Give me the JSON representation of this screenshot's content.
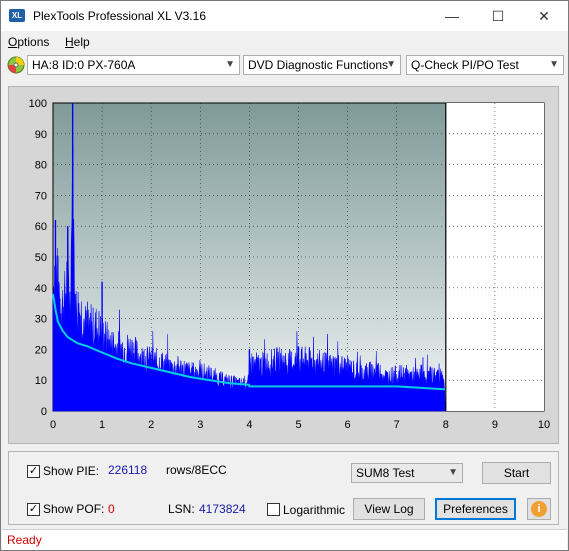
{
  "window": {
    "title": "PlexTools Professional XL V3.16",
    "icon_text": "XL"
  },
  "menu": [
    {
      "label": "Options",
      "ul": "O",
      "rest": "ptions"
    },
    {
      "label": "Help",
      "ul": "H",
      "rest": "elp"
    }
  ],
  "toolbar": {
    "drive": "HA:8 ID:0  PX-760A",
    "function": "DVD Diagnostic Functions",
    "test": "Q-Check PI/PO Test"
  },
  "chart_data": {
    "type": "area",
    "xlim": [
      0,
      10
    ],
    "ylim": [
      0,
      100
    ],
    "x_ticks": [
      "0",
      "1",
      "2",
      "3",
      "4",
      "5",
      "6",
      "7",
      "8",
      "9",
      "10"
    ],
    "y_ticks": [
      "0",
      "10",
      "20",
      "30",
      "40",
      "50",
      "60",
      "70",
      "80",
      "90",
      "100"
    ],
    "grid": true,
    "colors": {
      "pie": "#0000ff",
      "avg": "#00cfe0",
      "plot_bg": "#9fb4b4",
      "end_line": "#000000"
    },
    "series": [
      {
        "kind": "pie_envelope",
        "x": [
          0.0,
          0.05,
          0.1,
          0.15,
          0.2,
          0.25,
          0.3,
          0.35,
          0.4,
          0.45,
          0.5,
          0.6,
          0.7,
          0.8,
          0.9,
          1.0,
          1.2,
          1.4,
          1.6,
          1.8,
          2.0,
          2.2,
          2.4,
          2.6,
          2.8,
          3.0,
          3.2,
          3.4,
          3.6,
          3.8,
          3.99,
          4.0,
          4.2,
          4.4,
          4.6,
          4.8,
          5.0,
          5.2,
          5.4,
          5.6,
          5.8,
          6.0,
          6.2,
          6.4,
          6.6,
          6.8,
          7.0,
          7.2,
          7.4,
          7.6,
          7.8,
          7.95,
          8.0
        ],
        "y": [
          50,
          62,
          52,
          45,
          44,
          47,
          60,
          43,
          100,
          41,
          43,
          40,
          33,
          34,
          35,
          32,
          27,
          26,
          26,
          22,
          21,
          20,
          18,
          18,
          16,
          16,
          15,
          13,
          12,
          11,
          12,
          20,
          19,
          20,
          21,
          20,
          21,
          21,
          20,
          19,
          19,
          18,
          16,
          16,
          17,
          14,
          15,
          15,
          14,
          14,
          15,
          16,
          0
        ]
      },
      {
        "kind": "avg",
        "x": [
          0.0,
          0.05,
          0.1,
          0.2,
          0.3,
          0.4,
          0.5,
          0.7,
          1.0,
          1.3,
          1.6,
          2.0,
          2.4,
          2.8,
          3.2,
          3.6,
          3.99,
          4.0,
          4.5,
          5.0,
          5.5,
          6.0,
          6.5,
          7.0,
          7.5,
          8.0
        ],
        "y": [
          38,
          33,
          29,
          26,
          24,
          23,
          22,
          21,
          19,
          17,
          15.5,
          14,
          12.5,
          11,
          10,
          9,
          8.5,
          8,
          8,
          8,
          8,
          8,
          8,
          8,
          7.5,
          7
        ]
      }
    ],
    "end_marker_x": 8.0
  },
  "panel": {
    "show_pie_label": "Show PIE:",
    "show_pie_checked": "✓",
    "pie_value": "226118",
    "pie_unit": "rows/8ECC",
    "show_pof_label": "Show POF:",
    "show_pof_checked": "✓",
    "pof_value": "0",
    "lsn_label": "LSN:",
    "lsn_value": "4173824",
    "log_label": "Logarithmic",
    "sum_select": "SUM8 Test",
    "start": "Start",
    "view_log": "View Log",
    "preferences": "Preferences",
    "info": "i"
  },
  "status": "Ready"
}
